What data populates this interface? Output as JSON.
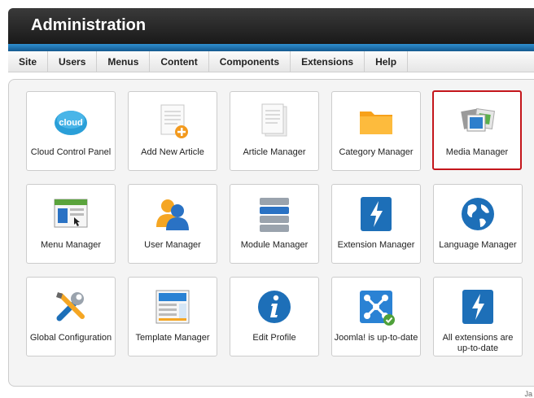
{
  "header": {
    "title": "Administration"
  },
  "menubar": {
    "items": [
      "Site",
      "Users",
      "Menus",
      "Content",
      "Components",
      "Extensions",
      "Help"
    ]
  },
  "tiles": [
    {
      "label": "Cloud Control Panel",
      "icon": "cloud-icon"
    },
    {
      "label": "Add New Article",
      "icon": "add-article-icon"
    },
    {
      "label": "Article Manager",
      "icon": "article-icon"
    },
    {
      "label": "Category Manager",
      "icon": "folder-icon"
    },
    {
      "label": "Media Manager",
      "icon": "media-icon",
      "selected": true
    },
    {
      "label": "Menu Manager",
      "icon": "menu-icon"
    },
    {
      "label": "User Manager",
      "icon": "users-icon"
    },
    {
      "label": "Module Manager",
      "icon": "module-icon"
    },
    {
      "label": "Extension Manager",
      "icon": "extension-icon"
    },
    {
      "label": "Language Manager",
      "icon": "globe-icon"
    },
    {
      "label": "Global Configuration",
      "icon": "tools-icon"
    },
    {
      "label": "Template Manager",
      "icon": "template-icon"
    },
    {
      "label": "Edit Profile",
      "icon": "info-icon"
    },
    {
      "label": "Joomla! is up-to-date",
      "icon": "joomla-icon"
    },
    {
      "label": "All extensions are up-to-date",
      "icon": "bolt-icon"
    }
  ],
  "corner_text": "Ja",
  "colors": {
    "selected_border": "#c4161c",
    "header_stripe": "#1f74b3"
  }
}
